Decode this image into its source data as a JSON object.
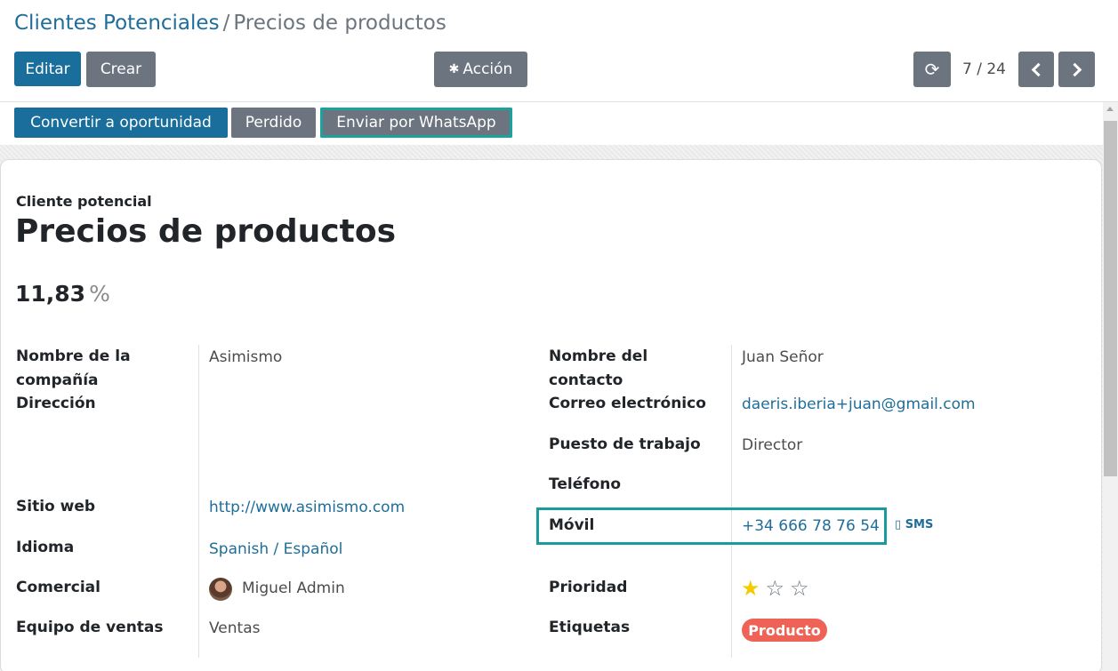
{
  "breadcrumb": {
    "parent": "Clientes Potenciales",
    "separator": "/",
    "current": "Precios de productos"
  },
  "toolbar": {
    "edit_label": "Editar",
    "create_label": "Crear",
    "action_label": "Acción",
    "refresh_icon": "refresh-icon",
    "pager": "7 / 24"
  },
  "status_buttons": {
    "convert": "Convertir a oportunidad",
    "lost": "Perdido",
    "whatsapp": "Enviar por WhatsApp"
  },
  "record": {
    "type_label": "Cliente potencial",
    "title": "Precios de productos",
    "probability": "11,83",
    "probability_unit": "%"
  },
  "left_fields": {
    "company_label": "Nombre de la compañía",
    "company_value": "Asimismo",
    "address_label": "Dirección",
    "website_label": "Sitio web",
    "website_value": "http://www.asimismo.com",
    "language_label": "Idioma",
    "language_value": "Spanish / Español",
    "salesperson_label": "Comercial",
    "salesperson_value": "Miguel Admin",
    "team_label": "Equipo de ventas",
    "team_value": "Ventas"
  },
  "right_fields": {
    "contact_label": "Nombre del contacto",
    "contact_value": "Juan Señor",
    "email_label": "Correo electrónico",
    "email_value": "daeris.iberia+juan@gmail.com",
    "job_label": "Puesto de trabajo",
    "job_value": "Director",
    "phone_label": "Teléfono",
    "mobile_label": "Móvil",
    "mobile_value": "+34 666 78 76 54",
    "sms_label": "SMS",
    "priority_label": "Prioridad",
    "priority_value": 1,
    "priority_max": 3,
    "tags_label": "Etiquetas",
    "tag_value": "Producto"
  },
  "colors": {
    "primary": "#1a6e9c",
    "secondary": "#6c7480",
    "highlight": "#159d99",
    "tag": "#ef6356",
    "star": "#f3cc00"
  }
}
